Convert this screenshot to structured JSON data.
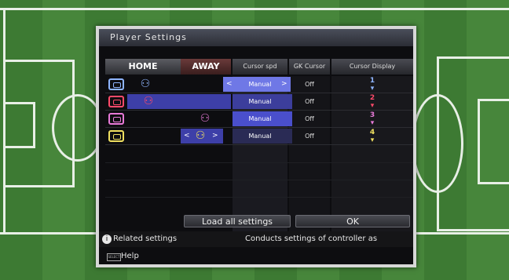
{
  "panel": {
    "title": "Player Settings"
  },
  "headers": {
    "home": "HOME",
    "away": "AWAY",
    "cursor_spd": "Cursor spd",
    "gk_cursor": "GK Cursor",
    "cursor_display": "Cursor Display"
  },
  "rows": [
    {
      "controller_color": "#8fb5ff",
      "side": "home",
      "speed": "Manual",
      "gk": "Off",
      "display_num": "1",
      "display_color": "#8fb5ff",
      "selected": true
    },
    {
      "controller_color": "#ff4a6a",
      "side": "home-right",
      "speed": "Manual",
      "gk": "Off",
      "display_num": "2",
      "display_color": "#ff4a6a",
      "selected": false
    },
    {
      "controller_color": "#e87ad8",
      "side": "away",
      "speed": "Manual",
      "gk": "Off",
      "display_num": "3",
      "display_color": "#e87ad8",
      "selected": false
    },
    {
      "controller_color": "#f0e060",
      "side": "center",
      "speed": "Manual",
      "gk": "Off",
      "display_num": "4",
      "display_color": "#f0e060",
      "selected": false
    }
  ],
  "arrows": {
    "left": "<",
    "right": ">"
  },
  "buttons": {
    "load": "Load all settings",
    "ok": "OK"
  },
  "footer": {
    "left": "Related settings",
    "right": "Conducts settings of controller as"
  },
  "help": {
    "select_label": "SELECT",
    "text": "Help"
  },
  "icons": {
    "player": "player-icon",
    "controller": "controller-icon",
    "info": "info-icon"
  }
}
